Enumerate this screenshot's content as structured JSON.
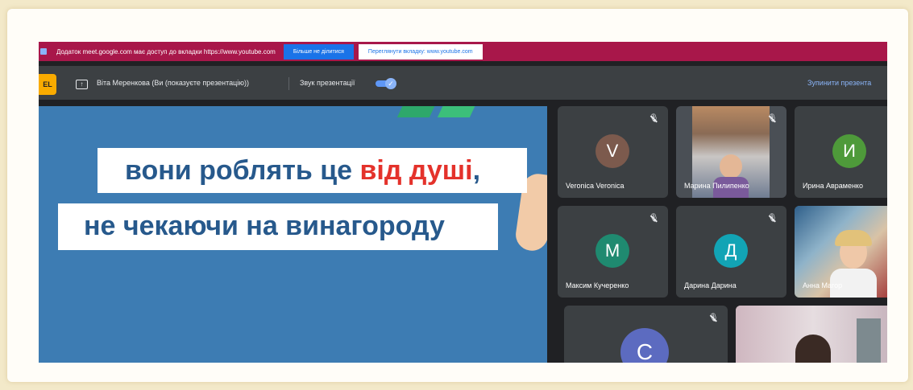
{
  "banner": {
    "message": "Додаток meet.google.com має доступ до вкладки https://www.youtube.com",
    "stop_sharing": "Більше не ділитися",
    "switch_tab": "Переглянути вкладку: www.youtube.com"
  },
  "presenting_bar": {
    "logo_text": "EL",
    "presenter": "Віта Мерeнкова (Ви (показуєте презентацію))",
    "sound_label": "Звук презентації",
    "sound_enabled": true,
    "stop_label": "Зупинити презента"
  },
  "slide": {
    "line1_part1": "вони роблять це ",
    "line1_highlight": "від душі",
    "line1_part2": ",",
    "line2": "не чекаючи на винагороду",
    "colors": {
      "background": "#3d7cb3",
      "text": "#27598c",
      "highlight": "#e4322b"
    }
  },
  "participants": [
    {
      "name": "Veronica Veronica",
      "initial": "V",
      "color": "#7c5a4d"
    },
    {
      "name": "Марина Пилипенко",
      "initial": "",
      "color": ""
    },
    {
      "name": "Ирина Авраменко",
      "initial": "И",
      "color": "#4e9a3a"
    },
    {
      "name": "Максим Кучеренко",
      "initial": "М",
      "color": "#1f8a70"
    },
    {
      "name": "Дарина Дарина",
      "initial": "Д",
      "color": "#12a4b5"
    },
    {
      "name": "Анна Магор",
      "initial": "",
      "color": ""
    },
    {
      "name": "",
      "initial": "С",
      "color": "#5c6bc0"
    }
  ]
}
